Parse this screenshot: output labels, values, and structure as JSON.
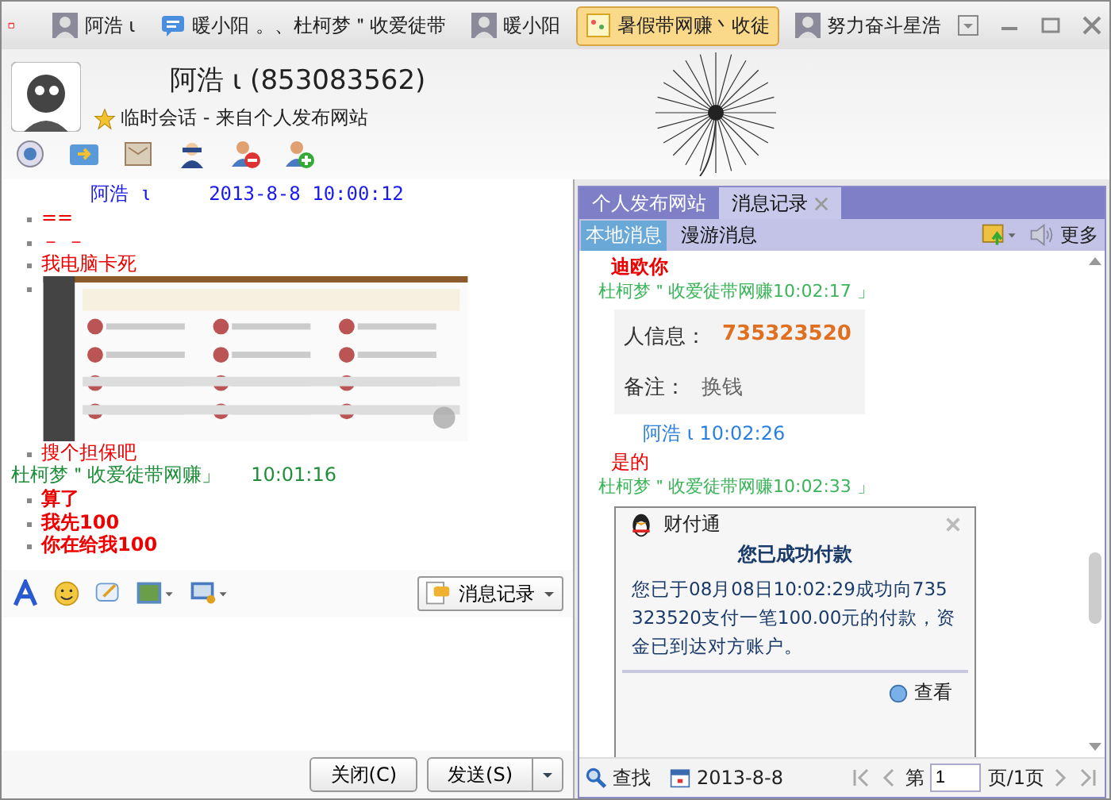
{
  "window_tabs": [
    {
      "label": "阿浩 ι",
      "kind": "avatar",
      "selected": false
    },
    {
      "label": "暖小阳 。、杜柯梦＂收爱徒带",
      "kind": "group",
      "selected": false
    },
    {
      "label": "暖小阳",
      "kind": "avatar",
      "selected": false
    },
    {
      "label": "暑假带网赚丶收徒",
      "kind": "note",
      "selected": true
    },
    {
      "label": "努力奋斗星浩",
      "kind": "avatar",
      "selected": false
    }
  ],
  "header": {
    "name": "阿浩 ι (853083562)",
    "subtitle": "临时会话 - 来自个人发布网站"
  },
  "chat": [
    {
      "kind": "sender",
      "name": "阿浩 ι",
      "time": "2013-8-8 10:00:12",
      "color": "#1a1aee"
    },
    {
      "kind": "bullet",
      "text": "==",
      "bold": false
    },
    {
      "kind": "bullet",
      "text": "－ －",
      "bold": false
    },
    {
      "kind": "bullet",
      "text": "我电脑卡死",
      "bold": false
    },
    {
      "kind": "image"
    },
    {
      "kind": "bullet",
      "text": "搜个担保吧",
      "bold": false
    },
    {
      "kind": "sender",
      "name": "杜柯梦＂收爱徒带网赚」",
      "time": "10:01:16",
      "color": "#1f8f3a"
    },
    {
      "kind": "bullet",
      "text": "算了",
      "bold": true
    },
    {
      "kind": "bullet",
      "text": "我先100",
      "bold": true
    },
    {
      "kind": "bullet",
      "text": "你在给我100",
      "bold": true
    }
  ],
  "input_toolbar": {
    "history_button": "消息记录"
  },
  "buttons": [
    {
      "label": "关闭(C)",
      "kind": "plain"
    },
    {
      "label": "发送(S)",
      "kind": "split"
    }
  ],
  "side_tabs": [
    {
      "label": "个人发布网站",
      "selected": false,
      "closable": false
    },
    {
      "label": "消息记录",
      "selected": true,
      "closable": true
    }
  ],
  "sub_tabs": [
    {
      "label": "本地消息",
      "selected": true
    },
    {
      "label": "漫游消息",
      "selected": false
    }
  ],
  "more": "更多",
  "history": [
    {
      "kind": "text",
      "text": "迪欧你",
      "bold": true
    },
    {
      "kind": "sender",
      "text": "杜柯梦＂收爱徒带网赚10:02:17 」",
      "color": "#3cb45a"
    },
    {
      "kind": "info_card",
      "rows": [
        {
          "label": "人信息：",
          "value": "735323520"
        },
        {
          "label": "备注：",
          "value": "换钱"
        }
      ]
    },
    {
      "kind": "sender",
      "text": "阿浩 ι 10:02:26",
      "color": "#2a7fe0"
    },
    {
      "kind": "text",
      "text": "是的",
      "bold": false
    },
    {
      "kind": "sender",
      "text": "杜柯梦＂收爱徒带网赚10:02:33 」",
      "color": "#3cb45a"
    },
    {
      "kind": "payment_card",
      "app": "财付通",
      "title": "您已成功付款",
      "body": "您已于08月08日10:02:29成功向735323520支付一笔100.00元的付款，资金已到达对方账户。",
      "link": "查看"
    }
  ],
  "footer": {
    "find": "查找",
    "date": "2013-8-8",
    "page_prefix": "第",
    "page": "1",
    "page_suffix": "页/1页"
  }
}
